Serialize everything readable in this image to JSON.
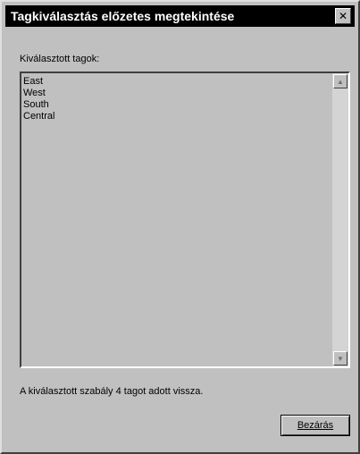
{
  "window": {
    "title": "Tagkiválasztás előzetes megtekintése",
    "close_glyph": "✕"
  },
  "list": {
    "label": "Kiválasztott tagok:",
    "items": [
      "East",
      "West",
      "South",
      "Central"
    ],
    "scroll_up_glyph": "▲",
    "scroll_down_glyph": "▼"
  },
  "status": {
    "message": "A kiválasztott szabály 4 tagot adott vissza."
  },
  "buttons": {
    "close_label": "Bezárás"
  }
}
